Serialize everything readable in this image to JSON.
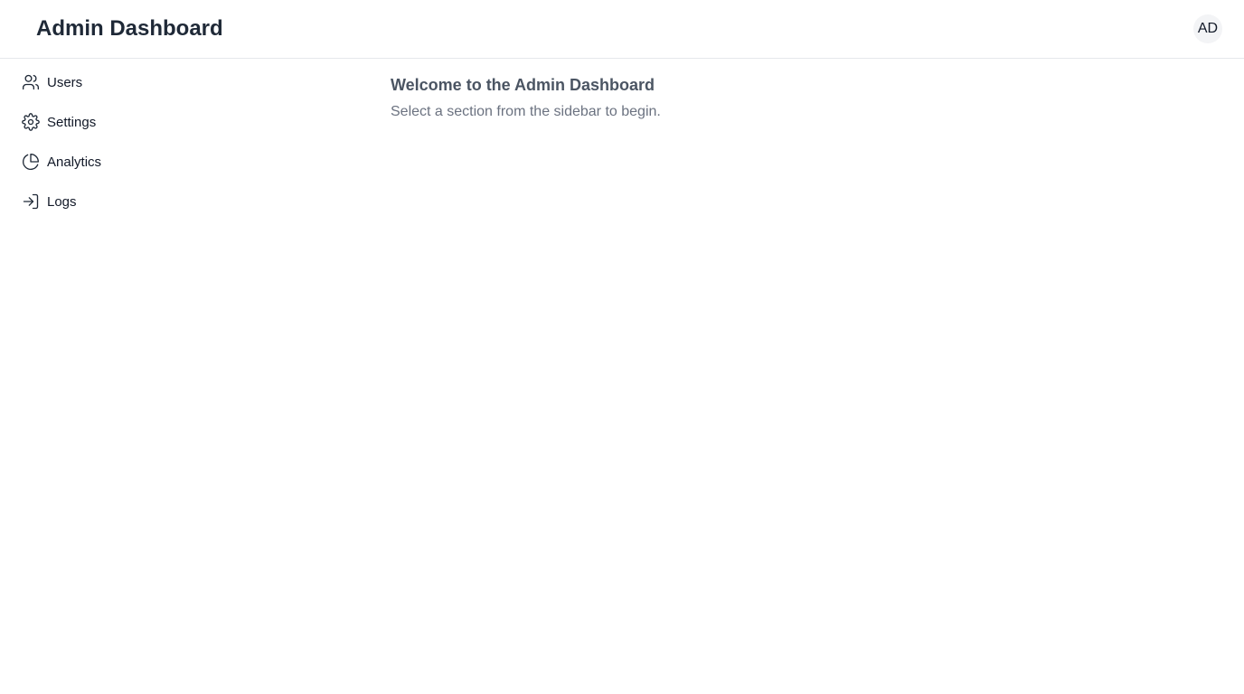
{
  "header": {
    "title": "Admin Dashboard",
    "avatar_initials": "AD"
  },
  "sidebar": {
    "items": [
      {
        "label": "Users",
        "icon": "users-icon"
      },
      {
        "label": "Settings",
        "icon": "gear-icon"
      },
      {
        "label": "Analytics",
        "icon": "pie-chart-icon"
      },
      {
        "label": "Logs",
        "icon": "log-in-icon"
      }
    ]
  },
  "main": {
    "title": "Welcome to the Admin Dashboard",
    "subtitle": "Select a section from the sidebar to begin."
  },
  "colors": {
    "title_text": "#1f2937",
    "muted_text": "#6b7280",
    "divider": "#e5e7eb",
    "avatar_bg": "#f3f4f6"
  }
}
